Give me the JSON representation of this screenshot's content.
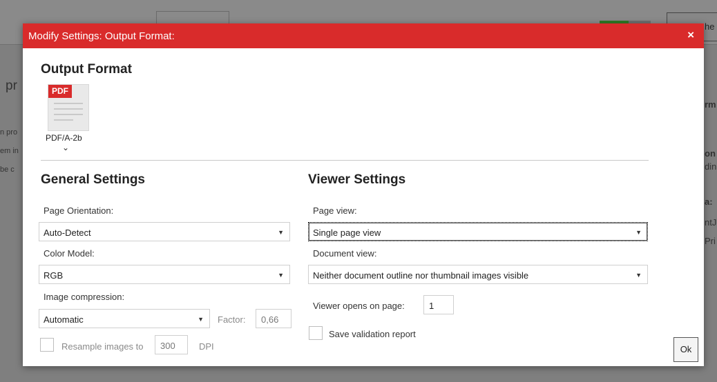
{
  "background": {
    "button_label": "he",
    "fragments": [
      "pr",
      "rm",
      "on",
      "din",
      "a:",
      "ntJ",
      "Pri",
      "n pro",
      "em in",
      "be c"
    ]
  },
  "dialog": {
    "title": "Modify Settings: Output Format:",
    "close_label": "×",
    "output_format": {
      "heading": "Output Format",
      "badge": "PDF",
      "caption": "PDF/A-2b",
      "chevron": "⌄"
    },
    "general": {
      "heading": "General Settings",
      "page_orientation_label": "Page Orientation:",
      "page_orientation_value": "Auto-Detect",
      "color_model_label": "Color Model:",
      "color_model_value": "RGB",
      "image_compression_label": "Image compression:",
      "image_compression_value": "Automatic",
      "factor_label": "Factor:",
      "factor_value": "0,66",
      "resample_label": "Resample images to",
      "resample_value": "300",
      "dpi_label": "DPI"
    },
    "viewer": {
      "heading": "Viewer Settings",
      "page_view_label": "Page view:",
      "page_view_value": "Single page view",
      "document_view_label": "Document view:",
      "document_view_value": "Neither document outline nor thumbnail images visible",
      "opens_on_page_label": "Viewer opens on page:",
      "opens_on_page_value": "1",
      "save_report_label": "Save validation report"
    },
    "ok_label": "Ok"
  },
  "colors": {
    "accent": "#d92b2b",
    "dialog_bg": "#ffffff"
  }
}
